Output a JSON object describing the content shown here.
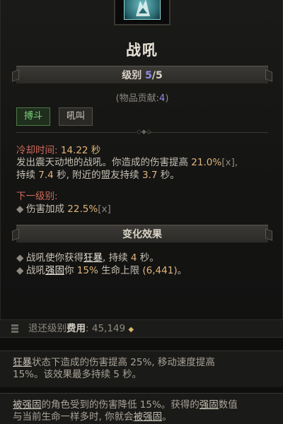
{
  "skill": {
    "icon": "war-cry-icon",
    "name": "战吼",
    "rank_label": "级别",
    "rank_current": "5",
    "rank_sep": "/",
    "rank_max": "5",
    "contribution_prefix": "(物品贡献:",
    "contribution_value": "4",
    "contribution_suffix": ")",
    "tags": [
      "搏斗",
      "吼叫"
    ]
  },
  "stats": {
    "cooldown_label": "冷却时间:",
    "cooldown_value": "14.22 秒",
    "desc_1a": "发出震天动地的战吼。你造成的伤害提高 ",
    "desc_1b": "21.0%",
    "desc_1c": "[x],",
    "desc_2a": "持续 ",
    "desc_2b": "7.4",
    "desc_2c": " 秒, 附近的盟友持续 ",
    "desc_2d": "3.7",
    "desc_2e": " 秒。",
    "next_rank_label": "下一级别:",
    "next_rank_item_a": "伤害加成 ",
    "next_rank_item_b": "22.5%",
    "next_rank_item_c": "[x]"
  },
  "modifiers": {
    "header": "变化效果",
    "items": [
      {
        "a": "战吼使你获得",
        "u": "狂暴",
        "b": ", 持续 ",
        "c": "4",
        "d": " 秒。"
      },
      {
        "a": "战吼",
        "u": "强固",
        "b": "你 ",
        "c": "15%",
        "d": " 生命上限 ",
        "e": "(6,441)",
        "f": "。"
      }
    ]
  },
  "refund": {
    "label": "退还级别",
    "cost_label": "费用",
    "colon": ":",
    "cost_value": "45,149",
    "currency_icon": "gold-icon"
  },
  "tooltips": {
    "berserk_term": "狂暴",
    "berserk_text_1": "状态下造成的伤害提高 25%, 移动速度提高",
    "berserk_text_2": "15%。该效果最多持续 5 秒。",
    "fortify_term": "被强固",
    "fortify_text_1": "的角色受到的伤害降低 15%。获得的",
    "fortify_term_2": "强固",
    "fortify_text_2": "数值",
    "fortify_text_3": "与当前生命一样多时, 你就会",
    "fortify_term_3": "被强固",
    "fortify_text_4": "。"
  }
}
